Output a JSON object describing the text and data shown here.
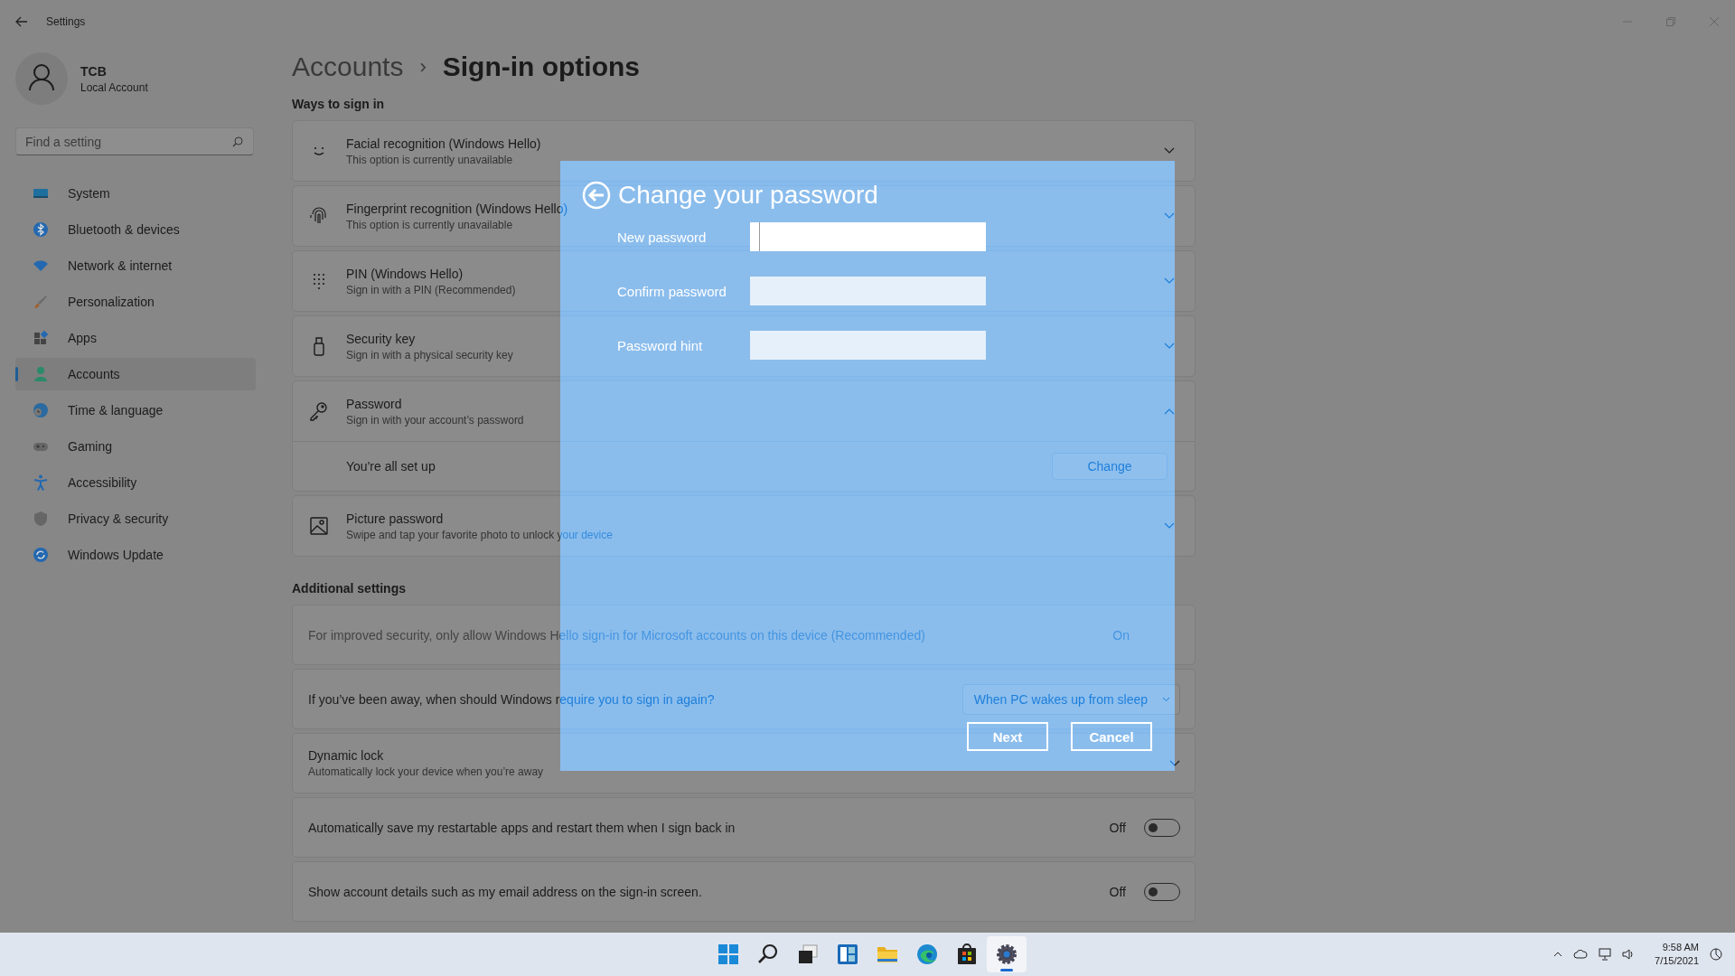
{
  "window": {
    "title": "Settings"
  },
  "user": {
    "name": "TCB",
    "account_type": "Local Account"
  },
  "search": {
    "placeholder": "Find a setting"
  },
  "nav": [
    {
      "label": "System",
      "selected": false
    },
    {
      "label": "Bluetooth & devices",
      "selected": false
    },
    {
      "label": "Network & internet",
      "selected": false
    },
    {
      "label": "Personalization",
      "selected": false
    },
    {
      "label": "Apps",
      "selected": false
    },
    {
      "label": "Accounts",
      "selected": true
    },
    {
      "label": "Time & language",
      "selected": false
    },
    {
      "label": "Gaming",
      "selected": false
    },
    {
      "label": "Accessibility",
      "selected": false
    },
    {
      "label": "Privacy & security",
      "selected": false
    },
    {
      "label": "Windows Update",
      "selected": false
    }
  ],
  "breadcrumb": {
    "parent": "Accounts",
    "separator": "›",
    "current": "Sign-in options"
  },
  "ways_heading": "Ways to sign in",
  "sign_in_options": [
    {
      "title": "Facial recognition (Windows Hello)",
      "subtitle": "This option is currently unavailable",
      "expanded": false
    },
    {
      "title": "Fingerprint recognition (Windows Hello)",
      "subtitle": "This option is currently unavailable",
      "expanded": false
    },
    {
      "title": "PIN (Windows Hello)",
      "subtitle": "Sign in with a PIN (Recommended)",
      "expanded": false
    },
    {
      "title": "Security key",
      "subtitle": "Sign in with a physical security key",
      "expanded": false
    },
    {
      "title": "Password",
      "subtitle": "Sign in with your account’s password",
      "expanded": true,
      "detail": {
        "text": "You're all set up",
        "button": "Change"
      }
    },
    {
      "title": "Picture password",
      "subtitle": "Swipe and tap your favorite photo to unlock your device",
      "expanded": false
    }
  ],
  "additional_heading": "Additional settings",
  "additional_settings": [
    {
      "kind": "status",
      "text": "For improved security, only allow Windows Hello sign-in for Microsoft accounts on this device (Recommended)",
      "value": "On",
      "disabled": true
    },
    {
      "kind": "dropdown",
      "text": "If you’ve been away, when should Windows require you to sign in again?",
      "value": "When PC wakes up from sleep"
    },
    {
      "kind": "expander",
      "title": "Dynamic lock",
      "subtitle": "Automatically lock your device when you’re away",
      "expanded": false
    },
    {
      "kind": "toggle",
      "text": "Automatically save my restartable apps and restart them when I sign back in",
      "value": "Off",
      "on": false
    },
    {
      "kind": "toggle",
      "text": "Show account details such as my email address on the sign-in screen.",
      "value": "Off",
      "on": false
    }
  ],
  "dialog": {
    "title": "Change your password",
    "fields": [
      {
        "label": "New password",
        "focused": true
      },
      {
        "label": "Confirm password",
        "focused": false
      },
      {
        "label": "Password hint",
        "focused": false
      }
    ],
    "buttons": [
      "Next",
      "Cancel"
    ]
  },
  "taskbar": {
    "apps": [
      {
        "selected": false
      },
      {
        "selected": false
      },
      {
        "selected": false
      },
      {
        "selected": false
      },
      {
        "selected": false
      },
      {
        "selected": false
      },
      {
        "selected": false
      },
      {
        "selected": true
      }
    ],
    "time": "9:58 AM",
    "date": "7/15/2021"
  }
}
